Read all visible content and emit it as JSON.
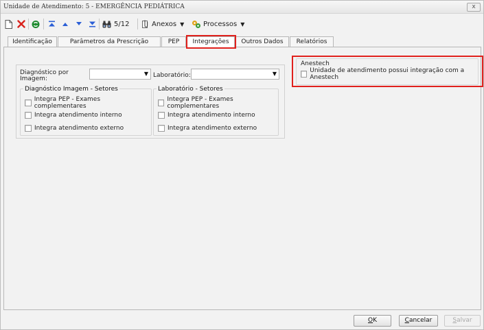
{
  "window": {
    "title": "Unidade de Atendimento: 5 - EMERGÊNCIA PEDIÁTRICA",
    "close_label": "x"
  },
  "toolbar": {
    "record_counter": "5/12",
    "anexos_label": "Anexos",
    "processos_label": "Processos"
  },
  "tabs": [
    {
      "label": "Identificação",
      "active": false
    },
    {
      "label": "Parâmetros da Prescrição",
      "active": false
    },
    {
      "label": "PEP",
      "active": false
    },
    {
      "label": "Integrações",
      "active": true
    },
    {
      "label": "Outros Dados",
      "active": false
    },
    {
      "label": "Relatórios",
      "active": false
    }
  ],
  "integracoes": {
    "diagnostico_label_line1": "Diagnóstico por",
    "diagnostico_label_line2": "Imagem:",
    "diagnostico_value": "",
    "laboratorio_label": "Laboratório:",
    "laboratorio_value": "",
    "diag_group": {
      "title": "Diagnóstico Imagem - Setores",
      "options": [
        {
          "label": "Integra PEP - Exames complementares",
          "checked": false
        },
        {
          "label": "Integra atendimento interno",
          "checked": false
        },
        {
          "label": "Integra atendimento externo",
          "checked": false
        }
      ]
    },
    "lab_group": {
      "title": "Laboratório - Setores",
      "options": [
        {
          "label": "Integra PEP - Exames complementares",
          "checked": false
        },
        {
          "label": "Integra atendimento interno",
          "checked": false
        },
        {
          "label": "Integra atendimento externo",
          "checked": false
        }
      ]
    },
    "anestech": {
      "title": "Anestech",
      "option_label": "Unidade de atendimento possui integração com a Anestech",
      "checked": false
    }
  },
  "buttons": {
    "ok_prefix": "",
    "ok_underlined": "O",
    "ok_rest": "K",
    "cancel_underlined": "C",
    "cancel_rest": "ancelar",
    "save_underlined": "S",
    "save_rest": "alvar"
  },
  "colors": {
    "highlight": "#e0201c",
    "delete_icon": "#d9231d",
    "refresh_icon": "#1d8a2e",
    "nav_icon": "#2b5fd6"
  }
}
